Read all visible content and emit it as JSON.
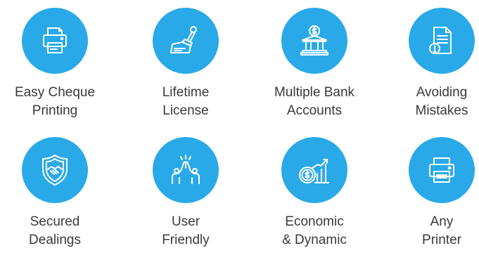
{
  "accent_color": "#2aa9e8",
  "features": [
    {
      "icon": "printer-cheque-icon",
      "line1": "Easy Cheque",
      "line2": "Printing"
    },
    {
      "icon": "stamp-icon",
      "line1": "Lifetime",
      "line2": "License"
    },
    {
      "icon": "bank-icon",
      "line1": "Multiple Bank",
      "line2": "Accounts"
    },
    {
      "icon": "document-alert-icon",
      "line1": "Avoiding",
      "line2": "Mistakes"
    },
    {
      "icon": "shield-handshake-icon",
      "line1": "Secured",
      "line2": "Dealings"
    },
    {
      "icon": "high-five-icon",
      "line1": "User",
      "line2": "Friendly"
    },
    {
      "icon": "coin-growth-icon",
      "line1": "Economic",
      "line2": "& Dynamic"
    },
    {
      "icon": "printer-icon",
      "line1": "Any",
      "line2": "Printer"
    }
  ]
}
